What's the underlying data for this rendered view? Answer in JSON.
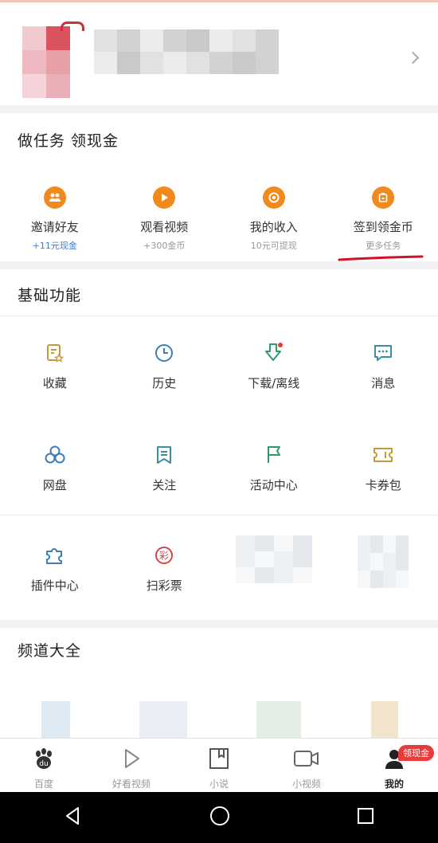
{
  "tasks": {
    "title": "做任务 领现金",
    "items": [
      {
        "label": "邀请好友",
        "sub": "+11元现金",
        "icon": "people-icon"
      },
      {
        "label": "观看视频",
        "sub": "+300金币",
        "icon": "play-icon"
      },
      {
        "label": "我的收入",
        "sub": "10元可提现",
        "icon": "income-icon"
      },
      {
        "label": "签到领金币",
        "sub": "更多任务",
        "icon": "calendar-icon"
      }
    ],
    "accent": "#f08a1c"
  },
  "basic": {
    "title": "基础功能",
    "items": [
      {
        "label": "收藏",
        "icon": "favorite-icon"
      },
      {
        "label": "历史",
        "icon": "clock-icon"
      },
      {
        "label": "下载/离线",
        "icon": "download-icon"
      },
      {
        "label": "消息",
        "icon": "message-icon"
      },
      {
        "label": "网盘",
        "icon": "cloud-disk-icon"
      },
      {
        "label": "关注",
        "icon": "follow-icon"
      },
      {
        "label": "活动中心",
        "icon": "flag-icon"
      },
      {
        "label": "卡券包",
        "icon": "coupon-icon"
      },
      {
        "label": "插件中心",
        "icon": "puzzle-icon"
      },
      {
        "label": "扫彩票",
        "icon": "lottery-icon"
      }
    ]
  },
  "channels": {
    "title": "频道大全"
  },
  "tabbar": {
    "items": [
      {
        "label": "百度",
        "icon": "baidu-paw-icon"
      },
      {
        "label": "好看视频",
        "icon": "play-outline-icon"
      },
      {
        "label": "小说",
        "icon": "book-icon"
      },
      {
        "label": "小视频",
        "icon": "video-camera-icon"
      },
      {
        "label": "我的",
        "icon": "user-icon"
      }
    ],
    "badge": "领现金"
  }
}
